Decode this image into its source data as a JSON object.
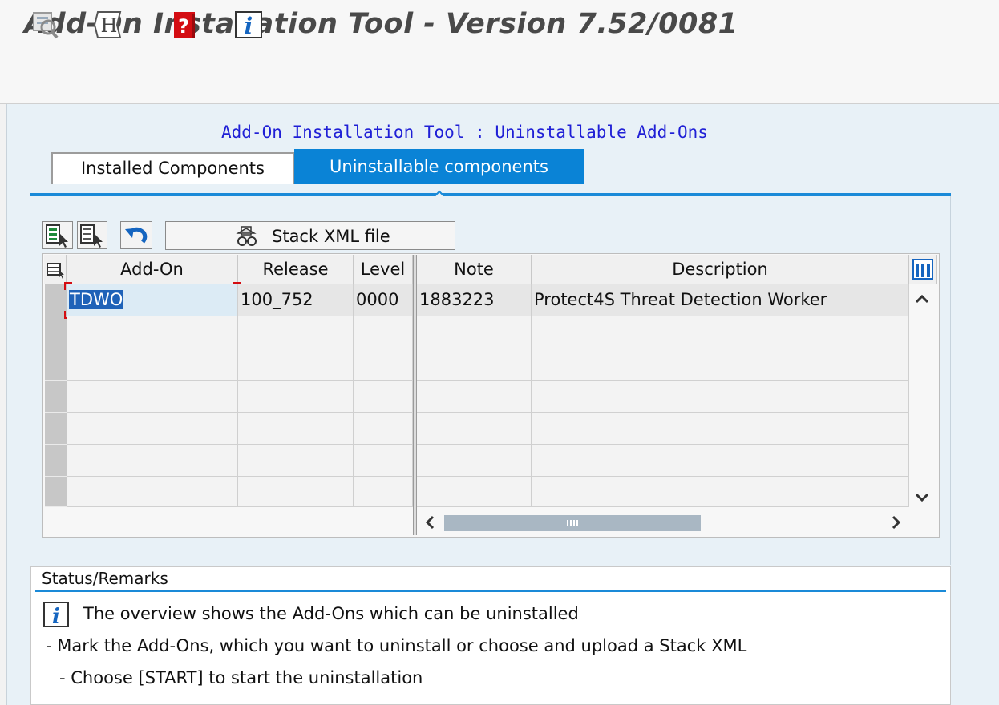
{
  "window": {
    "title": "Add-On Installation Tool - Version 7.52/0081"
  },
  "toolbar": {
    "icons": [
      "check-icon",
      "help-h-icon",
      "help-book-icon",
      "info-icon"
    ]
  },
  "page": {
    "heading": "Add-On Installation Tool : Uninstallable Add-Ons"
  },
  "tabs": [
    {
      "label": "Installed Components",
      "active": false
    },
    {
      "label": "Uninstallable components",
      "active": true
    }
  ],
  "actions": {
    "stack_xml_label": "Stack XML file"
  },
  "table": {
    "columns": [
      "Add-On",
      "Release",
      "Level",
      "Note",
      "Description"
    ],
    "rows": [
      {
        "addon": "TDWO",
        "release": "100_752",
        "level": "0000",
        "note": "1883223",
        "description": "Protect4S Threat Detection Worker"
      }
    ]
  },
  "status": {
    "title": "Status/Remarks",
    "lines": [
      "The overview shows the Add-Ons which can be uninstalled",
      "- Mark the Add-Ons, which you want to uninstall or choose and upload a Stack XML",
      "- Choose [START] to start the uninstallation"
    ]
  },
  "colors": {
    "accent": "#0a83d6",
    "heading": "#1f1fd6",
    "selection": "#1f62b8"
  }
}
